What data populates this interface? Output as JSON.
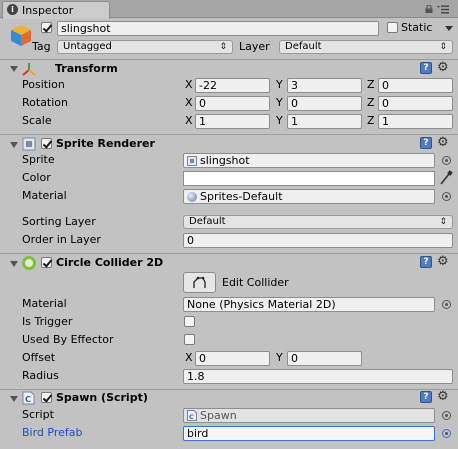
{
  "window": {
    "tab_label": "Inspector",
    "tab_icon_glyph": "i"
  },
  "gameobject": {
    "name": "slingshot",
    "active": true,
    "static_label": "Static",
    "static_checked": false,
    "tag_label": "Tag",
    "tag_value": "Untagged",
    "layer_label": "Layer",
    "layer_value": "Default"
  },
  "transform": {
    "title": "Transform",
    "rows": [
      {
        "label": "Position",
        "x": "-22",
        "y": "3",
        "z": "0"
      },
      {
        "label": "Rotation",
        "x": "0",
        "y": "0",
        "z": "0"
      },
      {
        "label": "Scale",
        "x": "1",
        "y": "1",
        "z": "1"
      }
    ]
  },
  "axes": {
    "x": "X",
    "y": "Y",
    "z": "Z"
  },
  "sprite_renderer": {
    "title": "Sprite Renderer",
    "enabled": true,
    "sprite_label": "Sprite",
    "sprite_value": "slingshot",
    "color_label": "Color",
    "color_value": "#ffffff",
    "material_label": "Material",
    "material_value": "Sprites-Default",
    "sorting_layer_label": "Sorting Layer",
    "sorting_layer_value": "Default",
    "order_label": "Order in Layer",
    "order_value": "0"
  },
  "circle_collider": {
    "title": "Circle Collider 2D",
    "enabled": true,
    "edit_button": "Edit Collider",
    "material_label": "Material",
    "material_value": "None (Physics Material 2D)",
    "is_trigger_label": "Is Trigger",
    "is_trigger": false,
    "used_by_effector_label": "Used By Effector",
    "used_by_effector": false,
    "offset_label": "Offset",
    "offset_x": "0",
    "offset_y": "0",
    "radius_label": "Radius",
    "radius_value": "1.8"
  },
  "spawn": {
    "title": "Spawn (Script)",
    "enabled": true,
    "script_label": "Script",
    "script_value": "Spawn",
    "bird_prefab_label": "Bird Prefab",
    "bird_prefab_value": "bird"
  },
  "colors": {
    "panel_bg": "#c2c2c2",
    "header_bg": "#b5b5b5",
    "field_bg": "#f0f0f0",
    "highlight_label": "#1c4ec8",
    "help_icon": "#4f7bc2"
  }
}
